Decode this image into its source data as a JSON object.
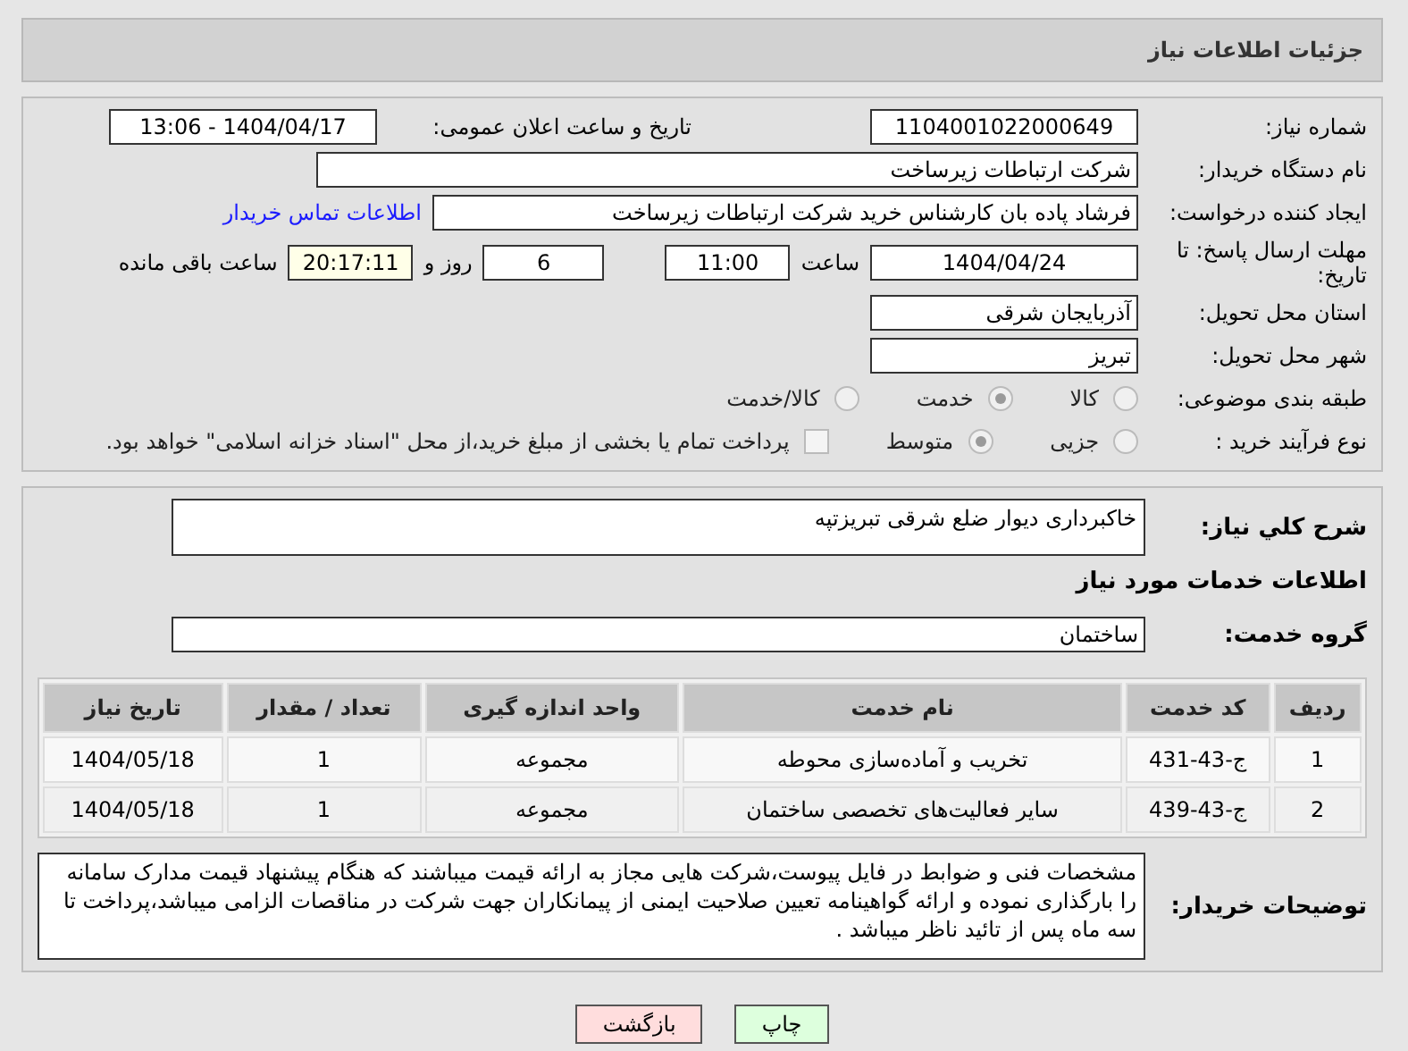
{
  "page_title": "جزئیات اطلاعات نیاز",
  "need_number": {
    "label": "شماره نیاز:",
    "value": "1104001022000649"
  },
  "announce": {
    "label": "تاریخ و ساعت اعلان عمومی:",
    "value": "1404/04/17 - 13:06"
  },
  "buyer_org": {
    "label": "نام دستگاه خریدار:",
    "value": "شرکت ارتباطات زیرساخت"
  },
  "requester": {
    "label": "ایجاد کننده درخواست:",
    "value": "فرشاد پاده بان کارشناس خرید شرکت ارتباطات زیرساخت",
    "link": "اطلاعات تماس خریدار"
  },
  "deadline": {
    "label": "مهلت ارسال پاسخ: تا تاریخ:",
    "date": "1404/04/24",
    "time_label": "ساعت",
    "time": "11:00",
    "days": "6",
    "days_label": "روز و",
    "remaining": "20:17:11",
    "remaining_label": "ساعت باقی مانده"
  },
  "province": {
    "label": "استان محل تحویل:",
    "value": "آذربایجان شرقی"
  },
  "city": {
    "label": "شهر محل تحویل:",
    "value": "تبریز"
  },
  "category": {
    "label": "طبقه بندی موضوعی:",
    "options": [
      {
        "label": "کالا",
        "selected": false
      },
      {
        "label": "خدمت",
        "selected": true
      },
      {
        "label": "کالا/خدمت",
        "selected": false
      }
    ]
  },
  "process": {
    "label": "نوع فرآیند خرید :",
    "options": [
      {
        "label": "جزیی",
        "selected": false
      },
      {
        "label": "متوسط",
        "selected": true
      }
    ],
    "payment_checkbox": {
      "checked": false,
      "label": "پرداخت تمام یا بخشی از مبلغ خرید،از محل \"اسناد خزانه اسلامی\" خواهد بود."
    }
  },
  "summary": {
    "label": "شرح کلي نياز:",
    "value": "خاکبرداری دیوار ضلع شرقی تبریزتپه"
  },
  "services_heading": "اطلاعات خدمات مورد نیاز",
  "service_group": {
    "label": "گروه خدمت:",
    "value": "ساختمان"
  },
  "table": {
    "columns": [
      "ردیف",
      "کد خدمت",
      "نام خدمت",
      "واحد اندازه گیری",
      "تعداد / مقدار",
      "تاریخ نیاز"
    ],
    "rows": [
      [
        "1",
        "ج-43-431",
        "تخریب و آماده‌سازی محوطه",
        "مجموعه",
        "1",
        "1404/05/18"
      ],
      [
        "2",
        "ج-43-439",
        "سایر فعالیت‌های تخصصی ساختمان",
        "مجموعه",
        "1",
        "1404/05/18"
      ]
    ]
  },
  "buyer_notes": {
    "label": "توضیحات خریدار:",
    "value": "مشخصات فنی و ضوابط در فایل پیوست،شرکت هایی مجاز به ارائه قیمت میباشند که هنگام پیشنهاد قیمت مدارک سامانه را بارگذاری نموده و ارائه گواهینامه تعیین صلاحیت ایمنی از پیمانکاران جهت شرکت در مناقصات الزامی میباشد،پرداخت تا سه ماه پس از تائید ناظر میباشد ."
  },
  "buttons": [
    {
      "label": "چاپ",
      "kind": "print"
    },
    {
      "label": "بازگشت",
      "kind": "back"
    }
  ]
}
